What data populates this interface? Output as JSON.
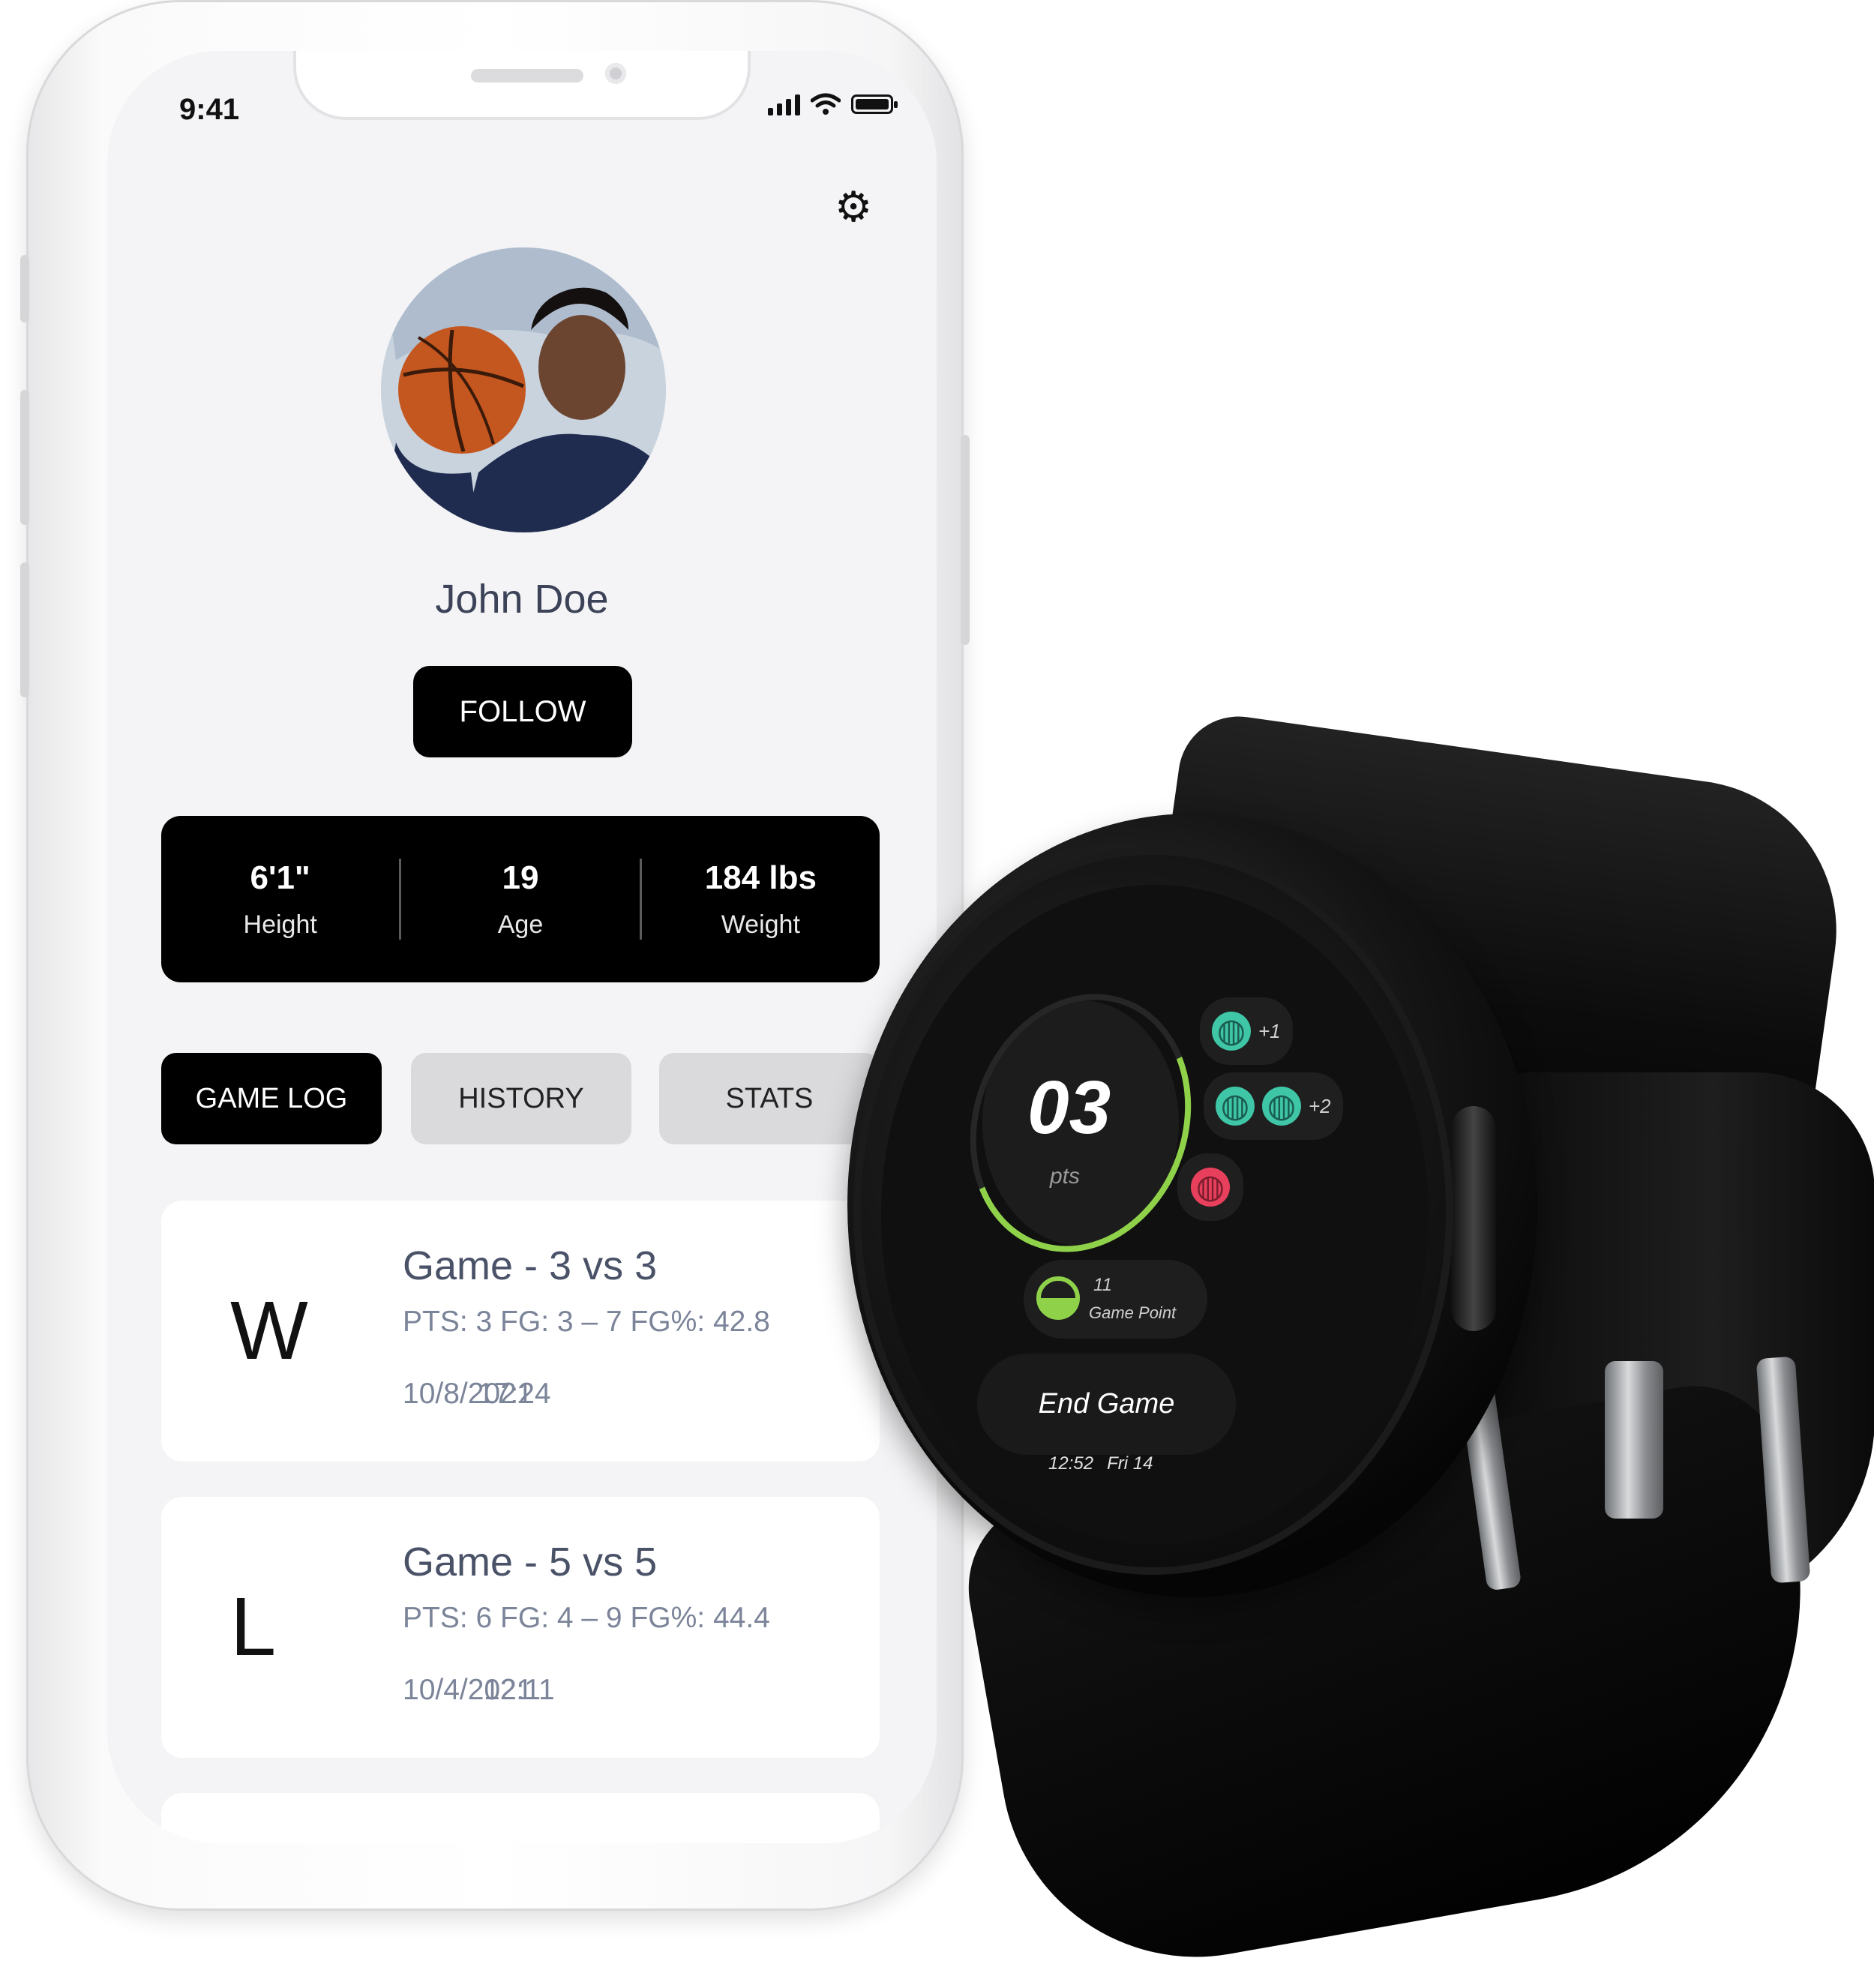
{
  "status_bar": {
    "time": "9:41"
  },
  "profile": {
    "name": "John Doe",
    "follow_label": "FOLLOW"
  },
  "stats": [
    {
      "value": "6'1\"",
      "label": "Height"
    },
    {
      "value": "19",
      "label": "Age"
    },
    {
      "value": "184 lbs",
      "label": "Weight"
    }
  ],
  "tabs": [
    {
      "label": "GAME LOG",
      "active": true
    },
    {
      "label": "HISTORY",
      "active": false
    },
    {
      "label": "STATS",
      "active": false
    }
  ],
  "games": [
    {
      "result": "W",
      "title": "Game - 3 vs 3",
      "stats": "PTS: 3 FG: 3 – 7 FG%: 42.8",
      "date": "10/8/2021",
      "time": "17:24"
    },
    {
      "result": "L",
      "title": "Game - 5 vs 5",
      "stats": "PTS: 6 FG: 4 – 9 FG%: 44.4",
      "date": "10/4/2021",
      "time": "12:11"
    }
  ],
  "watch": {
    "points": "03",
    "points_label": "pts",
    "shot_plus1": "+1",
    "shot_plus2": "+2",
    "game_point_value": "11",
    "game_point_label": "Game Point",
    "end_game_label": "End Game",
    "clock_time": "12:52",
    "clock_date": "Fri 14"
  },
  "colors": {
    "accent_green": "#8fd24a",
    "teal": "#3fc6a7",
    "red": "#e8405c",
    "screen_bg": "#f4f4f6"
  },
  "icons": [
    "settings-gear-icon",
    "signal-icon",
    "wifi-icon",
    "battery-icon",
    "basketball-icon",
    "game-point-icon"
  ]
}
